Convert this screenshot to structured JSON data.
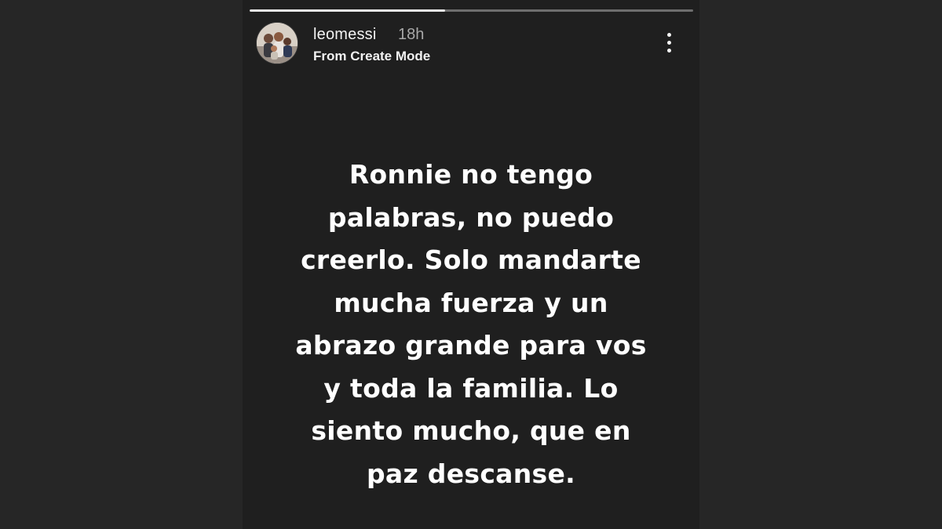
{
  "story": {
    "progress": 0.44,
    "user": {
      "username": "leomessi",
      "time": "18h",
      "subtitle": "From Create Mode"
    },
    "message_lines": [
      "Ronnie no tengo",
      "palabras, no puedo",
      "creerlo. Solo mandarte",
      "mucha fuerza y un",
      "abrazo grande para vos",
      "y toda la familia.  Lo",
      "siento mucho,  que en",
      "paz descanse."
    ]
  },
  "colors": {
    "background": "#262626",
    "story_background": "#1f1f1f",
    "text": "#ffffff",
    "muted_text": "#a8a8a8"
  },
  "icons": {
    "more": "more-options-icon"
  }
}
